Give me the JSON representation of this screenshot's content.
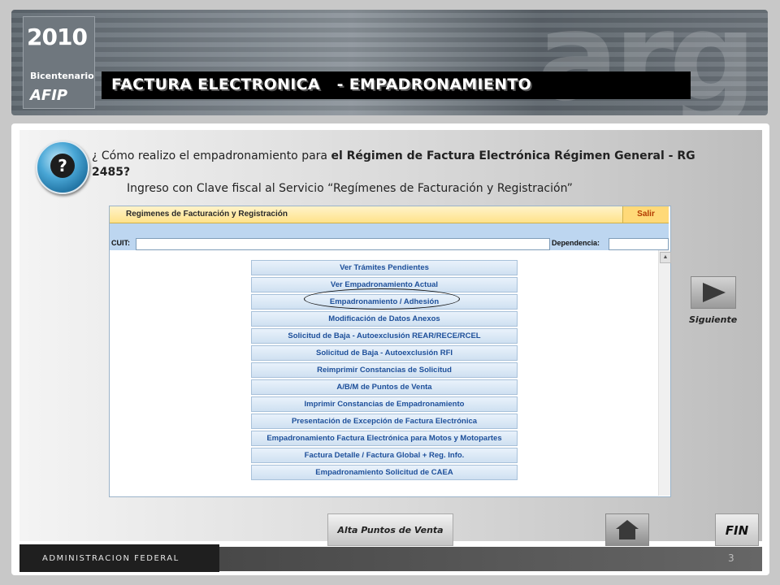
{
  "header": {
    "logo_year": "2010",
    "logo_sub": "Bicentenario",
    "logo_afip": "AFIP",
    "title": "FACTURA ELECTRONICA   - EMPADRONAMIENTO"
  },
  "question": {
    "line1_prefix": "¿ Cómo realizo el empadronamiento para ",
    "line1_bold": "el Régimen de Factura Electrónica Régimen General - RG 2485?",
    "line2": "Ingreso con Clave fiscal al Servicio “Regímenes de Facturación y Registración”"
  },
  "screenshot": {
    "bar_title": "Regimenes de Facturación y Registración",
    "salir": "Salir",
    "cuit_label": "CUIT:",
    "dependencia_label": "Dependencia:",
    "menu_items": [
      "Ver Trámites Pendientes",
      "Ver Empadronamiento Actual",
      "Empadronamiento / Adhesión",
      "Modificación de Datos Anexos",
      "Solicitud de Baja - Autoexclusión REAR/RECE/RCEL",
      "Solicitud de Baja - Autoexclusión RFI",
      "Reimprimir Constancias de Solicitud",
      "A/B/M de Puntos de Venta",
      "Imprimir Constancias de Empadronamiento",
      "Presentación de Excepción de Factura Electrónica",
      "Empadronamiento Factura Electrónica para Motos y Motopartes",
      "Factura Detalle / Factura Global + Reg. Info.",
      "Empadronamiento Solicitud de CAEA"
    ]
  },
  "nav": {
    "siguiente": "Siguiente",
    "alta": "Alta Puntos de Venta",
    "fin": "FIN"
  },
  "footer": {
    "brand": "ADMINISTRACION FEDERAL",
    "page": "3"
  }
}
